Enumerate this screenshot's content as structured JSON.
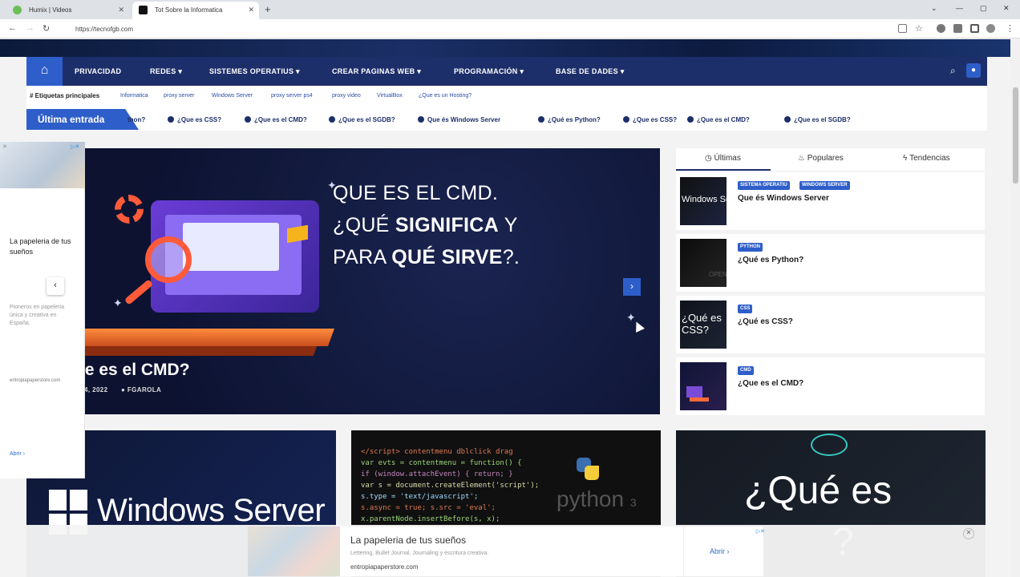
{
  "browser": {
    "tabs": [
      {
        "title": "Humix | Videos"
      },
      {
        "title": "Tot Sobre la Informatica"
      }
    ],
    "url": "https://tecnofgb.com"
  },
  "nav": {
    "items": [
      "PRIVACIDAD",
      "REDES",
      "SISTEMES OPERATIUS",
      "CREAR PAGINAS WEB",
      "PROGRAMACIÓN",
      "BASE DE DADES"
    ]
  },
  "tags": {
    "title": "# Etiquetas principales",
    "items": [
      "Informatica",
      "proxy server",
      "Windows Server",
      "proxy server ps4",
      "proxy video",
      "VirtualBox",
      "¿Que es un Hosting?"
    ]
  },
  "ticker": {
    "label": "Última entrada",
    "items": [
      "thon?",
      "¿Que es CSS?",
      "¿Que es el CMD?",
      "¿Que es el SGDB?",
      "Que és Windows Server",
      "¿Qué es Python?",
      "¿Que es CSS?",
      "¿Que es el CMD?",
      "¿Que es el SGDB?"
    ]
  },
  "hero": {
    "line1": "QUE ES EL CMD.",
    "line2_pre": "¿QUÉ ",
    "line2_bold": "SIGNIFICA",
    "line2_post": " Y",
    "line3_pre": "PARA ",
    "line3_bold": "QUÉ SIRVE",
    "line3_post": "?.",
    "title": "ue es el CMD?",
    "date": "4, 2022",
    "author": "FGAROLA"
  },
  "sidebar": {
    "tabs": [
      "Últimas",
      "Populares",
      "Tendencias"
    ],
    "posts": [
      {
        "categories": [
          "SISTEMA OPERATIU",
          "WINDOWS SERVER"
        ],
        "title": "Que és Windows Server",
        "thumb_text": "Windows Ser"
      },
      {
        "categories": [
          "PYTHON"
        ],
        "title": "¿Qué es Python?",
        "thumb_text": "OPEN"
      },
      {
        "categories": [
          "CSS"
        ],
        "title": "¿Qué es CSS?",
        "thumb_text": "¿Qué es CSS?"
      },
      {
        "categories": [
          "CMD"
        ],
        "title": "¿Que es el CMD?",
        "thumb_text": ""
      }
    ]
  },
  "cards": {
    "windows_server": "Windows Server",
    "python": "python",
    "python_small": "3",
    "css_line1": "¿Qué es",
    "css_line2": "?"
  },
  "ad_left": {
    "title": "La papeleria de tus sueños",
    "desc": "Pioneros en papeleria única y creativa en España.",
    "domain": "entropiapaperstore.com",
    "open": "Abrir"
  },
  "ad_bottom": {
    "title": "La papeleria de tus sueños",
    "desc": "Lettering, Bullet Journal, Journaling y escritura creativa.",
    "domain": "entropiapaperstore.com",
    "open": "Abrir"
  },
  "colors": {
    "nav": "#1d2f6a",
    "accent": "#2e5ec9"
  }
}
